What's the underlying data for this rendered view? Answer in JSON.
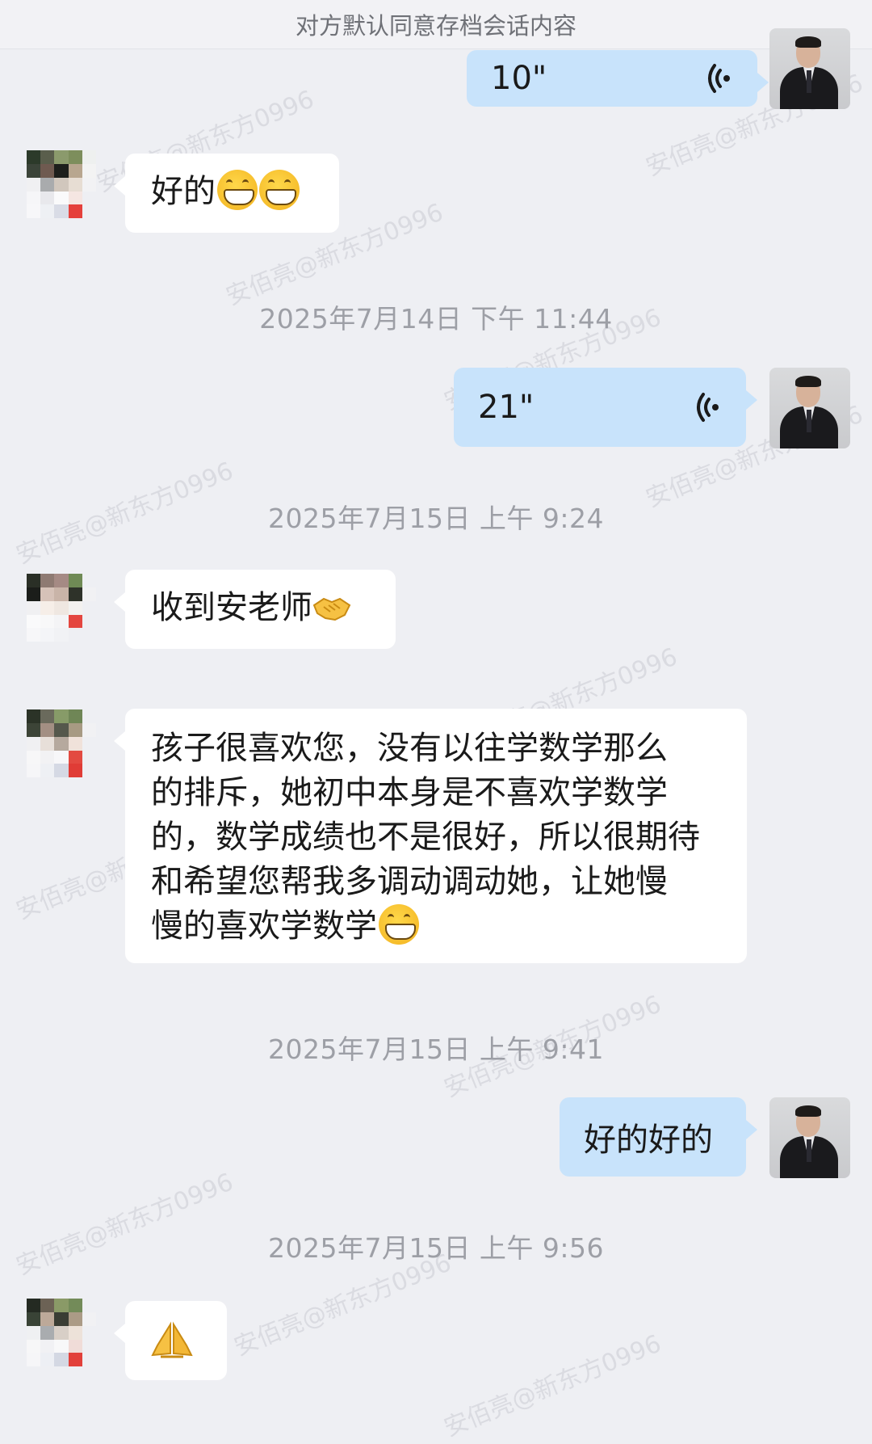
{
  "header": {
    "notice": "对方默认同意存档会话内容"
  },
  "watermark": "安佰亮@新东方0996",
  "colors": {
    "background": "#eeeff3",
    "bubble_in": "#ffffff",
    "bubble_out": "#c8e3fb",
    "timestamp": "#9d9fa6"
  },
  "messages": [
    {
      "side": "out",
      "type": "voice",
      "duration": "10\"",
      "icon": "voice-wave-icon"
    },
    {
      "side": "in",
      "type": "text",
      "text": "好的",
      "emoji": [
        "grinning-face-icon",
        "grinning-face-icon"
      ]
    },
    {
      "type": "timestamp",
      "text": "2025年7月14日  下午 11:44"
    },
    {
      "side": "out",
      "type": "voice",
      "duration": "21\"",
      "icon": "voice-wave-icon"
    },
    {
      "type": "timestamp",
      "text": "2025年7月15日  上午 9:24"
    },
    {
      "side": "in",
      "type": "text",
      "text": "收到安老师",
      "emoji": [
        "handshake-icon"
      ]
    },
    {
      "side": "in",
      "type": "text",
      "lines": [
        "孩子很喜欢您，没有以往学数学那么",
        "的排斥，她初中本身是不喜欢学数学",
        "的，数学成绩也不是很好，所以很期待",
        "和希望您帮我多调动调动她，让她慢",
        "慢的喜欢学数学"
      ],
      "emoji": [
        "grinning-face-icon"
      ]
    },
    {
      "type": "timestamp",
      "text": "2025年7月15日  上午 9:41"
    },
    {
      "side": "out",
      "type": "text",
      "text": "好的好的"
    },
    {
      "type": "timestamp",
      "text": "2025年7月15日  上午 9:56"
    },
    {
      "side": "in",
      "type": "emoji",
      "emoji": [
        "folded-hands-icon"
      ]
    }
  ]
}
